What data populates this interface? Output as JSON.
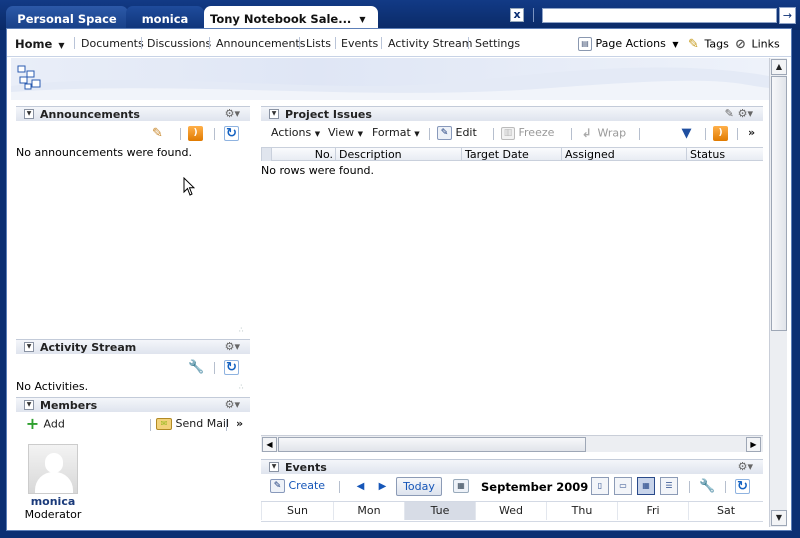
{
  "top_tabs": {
    "personal": "Personal Space",
    "monica": "monica",
    "tony": "Tony Notebook Sale...",
    "close_glyph": "x",
    "go_glyph": "→"
  },
  "nav": {
    "home": "Home",
    "items": [
      "Documents",
      "Discussions",
      "Announcements",
      "Lists",
      "Events",
      "Activity Stream",
      "Settings"
    ],
    "page_actions": "Page Actions",
    "tags": "Tags",
    "links": "Links"
  },
  "announcements": {
    "title": "Announcements",
    "empty": "No announcements were found."
  },
  "activity_stream": {
    "title": "Activity Stream",
    "empty": "No Activities."
  },
  "members": {
    "title": "Members",
    "add": "Add",
    "send_mail": "Send Mail",
    "more": "»",
    "member_name": "monica",
    "member_role": "Moderator"
  },
  "project_issues": {
    "title": "Project Issues",
    "toolbar": {
      "actions": "Actions",
      "view": "View",
      "format": "Format",
      "edit": "Edit",
      "freeze": "Freeze",
      "wrap": "Wrap",
      "more": "»"
    },
    "columns": [
      "No.",
      "Description",
      "Target Date",
      "Assigned",
      "Status"
    ],
    "empty": "No rows were found."
  },
  "events": {
    "title": "Events",
    "create": "Create",
    "today": "Today",
    "month": "September 2009",
    "days": [
      "Sun",
      "Mon",
      "Tue",
      "Wed",
      "Thu",
      "Fri",
      "Sat"
    ],
    "today_day": "Tue"
  },
  "colors": {
    "accent": "#0b2f73",
    "link": "#1656b8",
    "header_gradient_top": "#f4f6fa",
    "header_gradient_bottom": "#dfe4ee"
  }
}
